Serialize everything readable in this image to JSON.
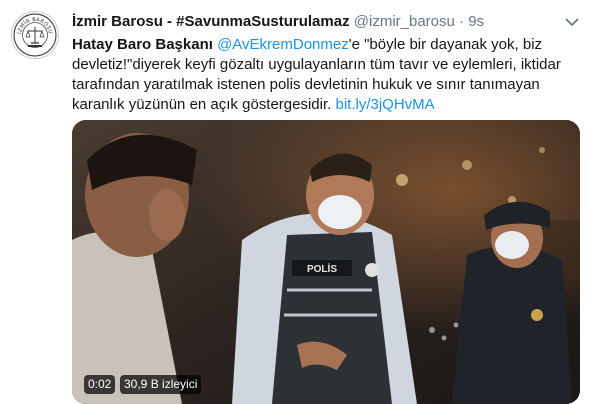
{
  "tweet": {
    "author_name": "İzmir Barosu - #SavunmaSusturulamaz",
    "handle": "@izmir_barosu",
    "separator": "·",
    "time": "9s",
    "text_bold": "Hatay Baro Başkanı",
    "mention": "@AvEkremDonmez",
    "text_after_mention": "'e \"böyle bir dayanak yok, biz devletiz!\"diyerek keyfi gözaltı uygulayanların tüm tavır ve eylemleri, iktidar tarafından yaratılmak istenen polis devletinin hukuk ve sınır tanımayan karanlık yüzünün en açık göstergesidir.",
    "link": "bit.ly/3jQHvMA"
  },
  "avatar": {
    "logo_text": "İZMİR BAROSU"
  },
  "video": {
    "elapsed": "0:02",
    "views": "30,9 B izleyici",
    "vest_label": "POLİS"
  },
  "colors": {
    "link": "#1b95e0",
    "text": "#14171a",
    "secondary": "#657786"
  },
  "icons": {
    "more": "chevron-down-icon"
  }
}
